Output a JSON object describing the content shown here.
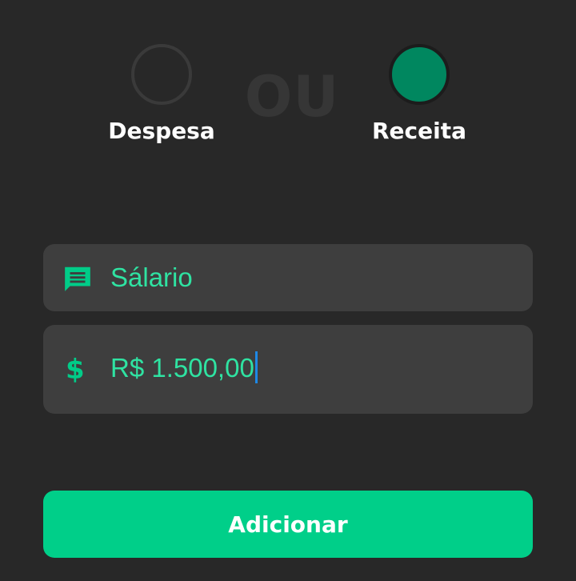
{
  "type_selector": {
    "options": [
      {
        "label": "Despesa",
        "selected": false
      },
      {
        "label": "Receita",
        "selected": true
      }
    ],
    "separator": "OU"
  },
  "form": {
    "description": {
      "icon": "chat-message-icon",
      "value": "Sálario"
    },
    "amount": {
      "icon": "dollar-icon",
      "icon_glyph": "$",
      "value": "R$ 1.500,00"
    },
    "submit_label": "Adicionar"
  },
  "colors": {
    "background": "#282828",
    "field_background": "#3e3e3e",
    "accent": "#00cf89",
    "accent_text": "#2fe3a2",
    "selected_radio": "#00875f",
    "caret": "#1e88e5"
  }
}
